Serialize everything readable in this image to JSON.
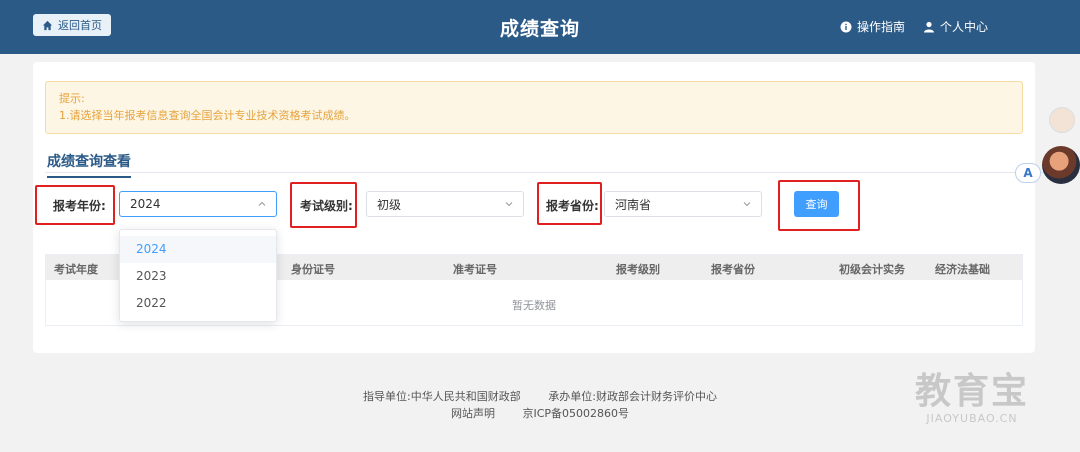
{
  "header": {
    "home_label": "返回首页",
    "title": "成绩查询",
    "guide_label": "操作指南",
    "personal_label": "个人中心"
  },
  "notice": {
    "title": "提示:",
    "text": "1.请选择当年报考信息查询全国会计专业技术资格考试成绩。"
  },
  "tab": {
    "label": "成绩查询查看"
  },
  "form": {
    "year_label": "报考年份:",
    "year_value": "2024",
    "level_label": "考试级别:",
    "level_value": "初级",
    "province_label": "报考省份:",
    "province_value": "河南省",
    "query_label": "查询"
  },
  "dropdown": {
    "options": [
      "2024",
      "2023",
      "2022"
    ],
    "selected": "2024"
  },
  "table": {
    "headers": [
      "考试年度",
      "身份证号",
      "准考证号",
      "报考级别",
      "报考省份",
      "初级会计实务",
      "经济法基础"
    ],
    "empty_text": "暂无数据"
  },
  "footer": {
    "guide_unit": "指导单位:中华人民共和国财政部",
    "host_unit": "承办单位:财政部会计财务评价中心",
    "statement": "网站声明",
    "icp": "京ICP备05002860号"
  },
  "side": {
    "translate_label": "A"
  },
  "watermark": {
    "brand": "教育宝",
    "url": "JIAOYUBAO.CN"
  },
  "colors": {
    "header": "#2b5a87",
    "accent": "#409eff",
    "notice": "#e6a23c",
    "highlight": "#e02020"
  }
}
